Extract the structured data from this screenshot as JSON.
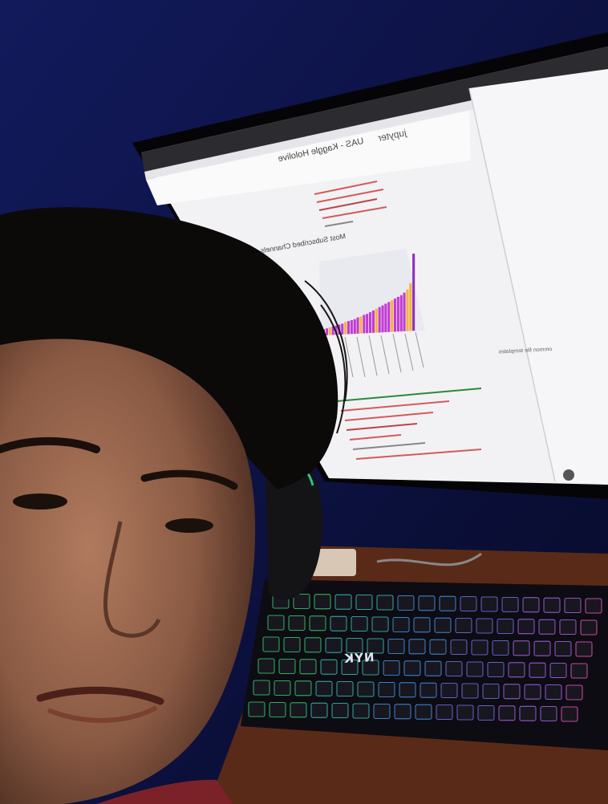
{
  "screen": {
    "app_name": "jupyter",
    "notebook_title": "UAS - Kaggle Hololive",
    "chart_title": "Most Subscribed Channels",
    "side_note": "ommon file templates"
  },
  "keyboard": {
    "brand": "NYK"
  },
  "chart_data": {
    "type": "bar",
    "title": "Most Subscribed Channels",
    "orientation": "descending",
    "values": [
      100,
      62,
      54,
      50,
      47,
      45,
      43,
      41,
      39,
      37,
      35,
      33,
      31,
      29,
      27,
      25,
      24,
      22,
      21,
      19,
      18,
      17,
      16,
      14,
      13,
      12,
      11,
      10,
      9,
      8
    ],
    "highlight_color": "#f4b43c",
    "bar_color": "#c23bd4",
    "accent_color": "#8e2fc0"
  },
  "colors": {
    "wall": "#0c1140",
    "screen": "#f2f2f4",
    "desk": "#5a2a18",
    "skin": "#8d5a44",
    "hair": "#0c0909"
  }
}
